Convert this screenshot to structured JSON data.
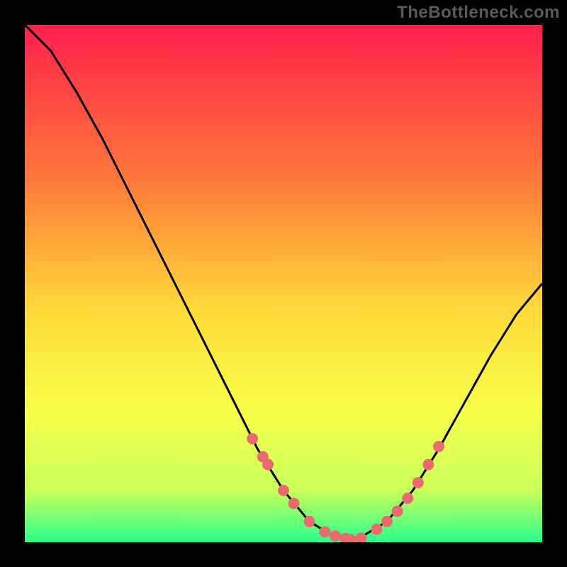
{
  "watermark": "TheBottleneck.com",
  "chart_data": {
    "type": "line",
    "title": "",
    "xlabel": "",
    "ylabel": "",
    "xlim": [
      0,
      1
    ],
    "ylim": [
      0,
      1
    ],
    "series": [
      {
        "name": "curve",
        "x": [
          0.0,
          0.05,
          0.1,
          0.15,
          0.2,
          0.25,
          0.3,
          0.35,
          0.4,
          0.45,
          0.5,
          0.55,
          0.6,
          0.625,
          0.65,
          0.7,
          0.75,
          0.8,
          0.85,
          0.9,
          0.95,
          1.0
        ],
        "y": [
          1.0,
          0.95,
          0.87,
          0.78,
          0.68,
          0.58,
          0.48,
          0.38,
          0.28,
          0.18,
          0.1,
          0.04,
          0.01,
          0.005,
          0.01,
          0.04,
          0.1,
          0.18,
          0.27,
          0.36,
          0.44,
          0.5
        ]
      }
    ],
    "markers": {
      "name": "highlight-dots",
      "color": "#e86b6e",
      "x": [
        0.44,
        0.46,
        0.47,
        0.5,
        0.52,
        0.55,
        0.58,
        0.6,
        0.62,
        0.63,
        0.65,
        0.68,
        0.7,
        0.72,
        0.74,
        0.76,
        0.78,
        0.8
      ],
      "y": [
        0.2,
        0.165,
        0.15,
        0.1,
        0.075,
        0.04,
        0.02,
        0.012,
        0.007,
        0.005,
        0.008,
        0.025,
        0.04,
        0.06,
        0.085,
        0.115,
        0.15,
        0.185
      ]
    },
    "background_gradient": {
      "top": "#ff1f4b",
      "mid1": "#ff7a3a",
      "mid2": "#ffd93b",
      "mid3": "#f7ff4a",
      "mid4": "#c9ff5a",
      "bottom": "#2bff8c"
    }
  }
}
